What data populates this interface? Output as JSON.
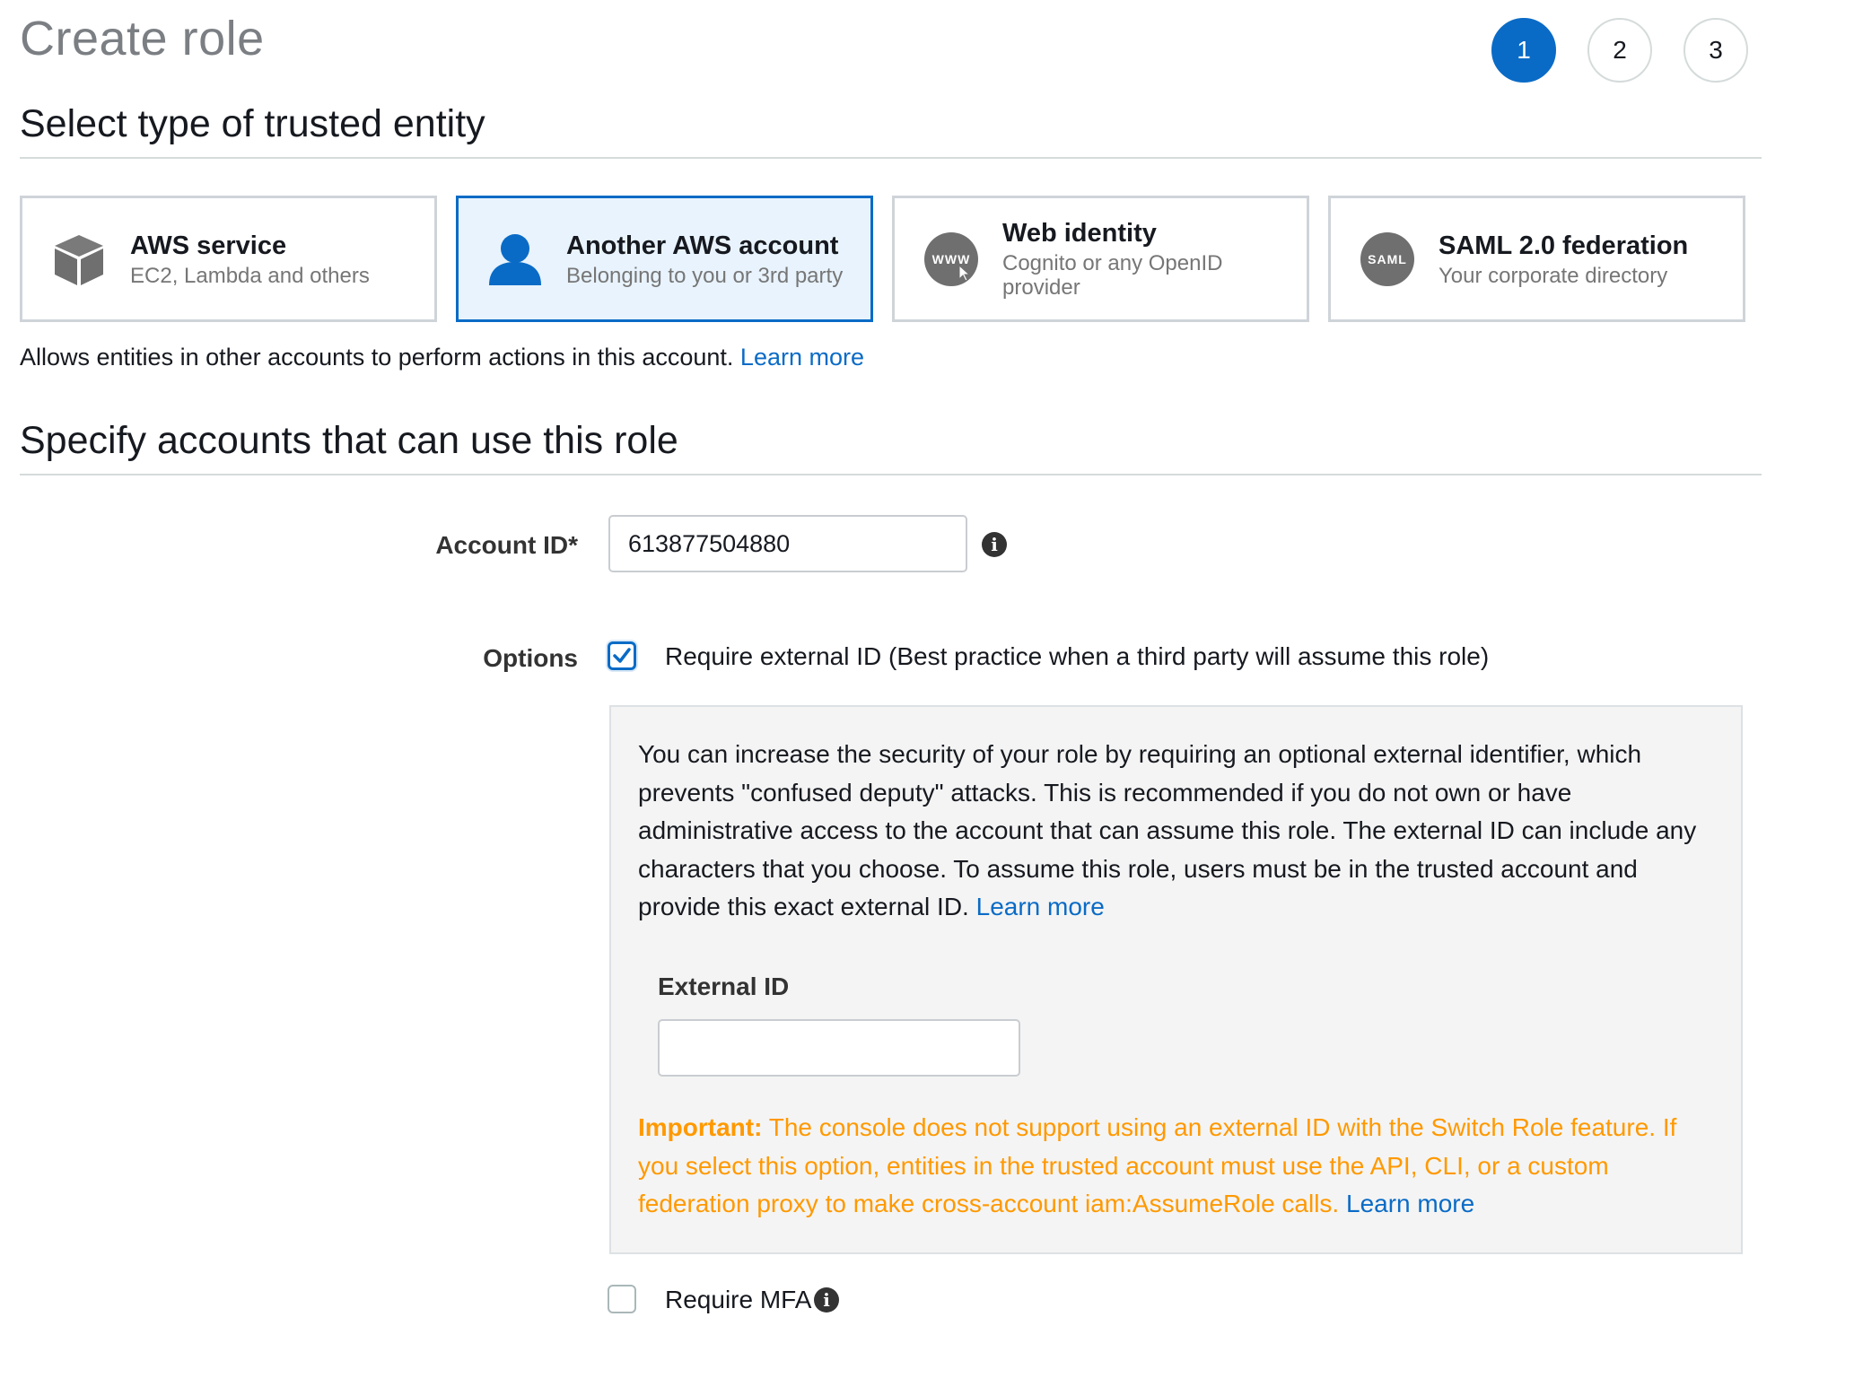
{
  "header": {
    "title": "Create role",
    "steps": [
      "1",
      "2",
      "3"
    ],
    "active_step": "1"
  },
  "trusted_entity": {
    "section_title": "Select type of trusted entity",
    "options": [
      {
        "title": "AWS service",
        "subtitle": "EC2, Lambda and others",
        "icon": "cube-icon",
        "selected": false
      },
      {
        "title": "Another AWS account",
        "subtitle": "Belonging to you or 3rd party",
        "icon": "user-icon",
        "selected": true
      },
      {
        "title": "Web identity",
        "subtitle": "Cognito or any OpenID provider",
        "icon": "www-icon",
        "selected": false
      },
      {
        "title": "SAML 2.0 federation",
        "subtitle": "Your corporate directory",
        "icon": "saml-icon",
        "selected": false
      }
    ],
    "icon_badges": {
      "www": "WWW",
      "saml": "SAML"
    },
    "description": "Allows entities in other accounts to perform actions in this account.",
    "learn_more": "Learn more"
  },
  "accounts": {
    "section_title": "Specify accounts that can use this role",
    "account_id_label": "Account ID*",
    "account_id_value": "613877504880",
    "options_label": "Options",
    "require_external_id_label": "Require external ID (Best practice when a third party will assume this role)",
    "require_external_id_checked": true,
    "external_id_info": "You can increase the security of your role by requiring an optional external identifier, which prevents \"confused deputy\" attacks. This is recommended if you do not own or have administrative access to the account that can assume this role. The external ID can include any characters that you choose. To assume this role, users must be in the trusted account and provide this exact external ID.",
    "external_id_learn_more": "Learn more",
    "external_id_label": "External ID",
    "external_id_value": "",
    "important_prefix": "Important:",
    "important_text": "The console does not support using an external ID with the Switch Role feature. If you select this option, entities in the trusted account must use the API, CLI, or a custom federation proxy to make cross-account iam:AssumeRole calls.",
    "important_learn_more": "Learn more",
    "require_mfa_label": "Require MFA",
    "require_mfa_checked": false
  },
  "colors": {
    "accent": "#0a6bc6",
    "warning": "#ff9900",
    "selected_bg": "#e8f3fd"
  }
}
